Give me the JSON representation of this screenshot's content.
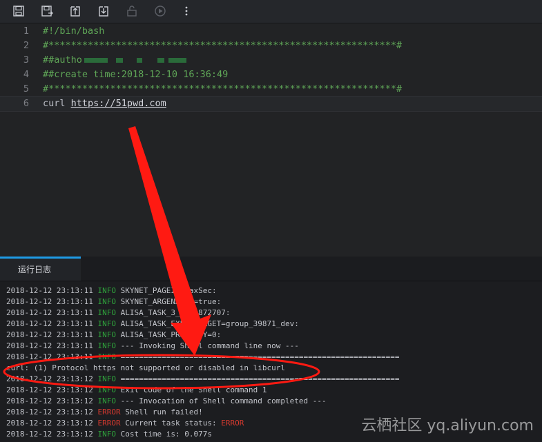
{
  "toolbar": {
    "buttons": [
      {
        "icon": "save-icon"
      },
      {
        "icon": "save-as-icon"
      },
      {
        "icon": "upload-icon"
      },
      {
        "icon": "download-icon"
      },
      {
        "icon": "lock-icon"
      },
      {
        "icon": "run-icon"
      },
      {
        "icon": "more-icon"
      }
    ]
  },
  "editor": {
    "lines": [
      {
        "num": "1",
        "text": "#!/bin/bash"
      },
      {
        "num": "2",
        "text": "#**************************************************************#"
      },
      {
        "num": "3",
        "text": "##autho"
      },
      {
        "num": "4",
        "text": "##create time:2018-12-10 16:36:49"
      },
      {
        "num": "5",
        "text": "#**************************************************************#"
      },
      {
        "num": "6",
        "cmd": "curl ",
        "url": "https://51pwd.com"
      }
    ]
  },
  "panel": {
    "tab_label": "运行日志"
  },
  "log": {
    "lines": [
      {
        "ts": "2018-12-12 23:13:11 ",
        "level": "INFO",
        "msg": " SKYNET_PAGEID=MaxSec:"
      },
      {
        "ts": "2018-12-12 23:13:11 ",
        "level": "INFO",
        "msg": " SKYNET_ARGENABLE=true:"
      },
      {
        "ts": "2018-12-12 23:13:11 ",
        "level": "INFO",
        "msg": " ALISA_TASK_3_0653872707:"
      },
      {
        "ts": "2018-12-12 23:13:11 ",
        "level": "INFO",
        "msg": " ALISA_TASK_EXEC_TARGET=group_39871_dev:"
      },
      {
        "ts": "2018-12-12 23:13:11 ",
        "level": "INFO",
        "msg": " ALISA_TASK_PRIORITY=0:"
      },
      {
        "ts": "2018-12-12 23:13:11 ",
        "level": "INFO",
        "msg": " --- Invoking Shell command line now ---"
      },
      {
        "ts": "2018-12-12 23:13:11 ",
        "level": "INFO",
        "msg": " ============================================================="
      },
      {
        "ts": "",
        "level": "",
        "msg": "curl: (1) Protocol https not supported or disabled in libcurl"
      },
      {
        "ts": "2018-12-12 23:13:12 ",
        "level": "INFO",
        "msg": " ============================================================="
      },
      {
        "ts": "2018-12-12 23:13:12 ",
        "level": "INFO",
        "msg": " Exit code of the Shell command 1"
      },
      {
        "ts": "2018-12-12 23:13:12 ",
        "level": "INFO",
        "msg": " --- Invocation of Shell command completed ---"
      },
      {
        "ts": "2018-12-12 23:13:12 ",
        "level": "ERROR",
        "msg": " Shell run failed!"
      },
      {
        "ts": "2018-12-12 23:13:12 ",
        "level": "ERROR",
        "msg": " Current task status: ",
        "tail": "ERROR"
      },
      {
        "ts": "2018-12-12 23:13:12 ",
        "level": "INFO",
        "msg": " Cost time is: 0.077s"
      }
    ]
  },
  "watermark": "云栖社区 yq.aliyun.com",
  "colors": {
    "annotation": "#ff1a12",
    "comment": "#5fa657",
    "info": "#2fa33c",
    "error": "#d83a2f"
  }
}
